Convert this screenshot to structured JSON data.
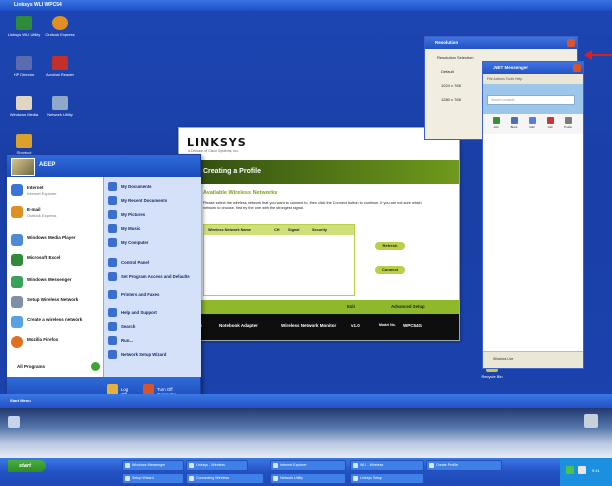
{
  "upper_window_title": "Linksys WLI WPC54",
  "desktop_icons": [
    {
      "label": "Linksys WLI Utility",
      "color": "#2e8b3b"
    },
    {
      "label": "Outlook Express",
      "color": "#e08f22"
    },
    {
      "label": "HP Director",
      "color": "#5a6cae"
    },
    {
      "label": "Acrobat Reader",
      "color": "#c2302b"
    },
    {
      "label": "Windows Media",
      "color": "#e0d6c1"
    },
    {
      "label": "Network Utility",
      "color": "#8fa7c8"
    },
    {
      "label": "Shortcut",
      "color": "#d9a22d"
    },
    {
      "label": "Recycle Bin",
      "color": "#c9c34a"
    }
  ],
  "start_menu": {
    "user_name": "AEEP",
    "left_items": [
      {
        "title": "Internet",
        "sub": "Internet Explorer",
        "color": "#3a74d8"
      },
      {
        "title": "E-mail",
        "sub": "Outlook Express",
        "color": "#e08f22"
      },
      {
        "title": "Windows Media Player",
        "sub": "",
        "color": "#4e8ad1"
      },
      {
        "title": "Microsoft Excel",
        "sub": "",
        "color": "#2f8a3b"
      },
      {
        "title": "Windows Messenger",
        "sub": "",
        "color": "#3aa15c"
      },
      {
        "title": "Setup Wireless Network",
        "sub": "",
        "color": "#7e8fa7"
      },
      {
        "title": "Create a wireless network",
        "sub": "",
        "color": "#56a2e3"
      },
      {
        "title": "Mozilla Firefox",
        "sub": "",
        "color": "#e07020"
      }
    ],
    "all_programs": "All Programs",
    "right_items": [
      "My Documents",
      "My Recent Documents",
      "My Pictures",
      "My Music",
      "My Computer",
      "Control Panel",
      "Set Program Access and Defaults",
      "Printers and Faxes",
      "Help and Support",
      "Search",
      "Run...",
      "Network Setup Wizard"
    ],
    "log_off": "Log Off",
    "turn_off": "Turn Off Computer"
  },
  "linksys": {
    "logo": "LINKSYS",
    "logo_sub": "A Division of Cisco Systems, Inc.",
    "heading": "Creating a Profile",
    "section_title": "Available Wireless Networks",
    "description": "Please select the wireless network that you want to connect to, then click the Connect button to continue. If you are not sure which network to choose, first try the one with the strongest signal.",
    "columns": [
      "Wireless Network Name",
      "CH",
      "Signal",
      "Security"
    ],
    "refresh_button": "Refresh",
    "connect_button": "Connect",
    "exit_label": "Exit",
    "advanced_label": "Advanced Setup",
    "status_speed": "802.11G",
    "status_product": "Notebook Adapter",
    "status_monitor": "Wireless Network Monitor",
    "status_version": "v1.0",
    "status_model_label": "Model No.",
    "status_model": "WPC54G"
  },
  "resolution_dialog": {
    "title": "Resolution",
    "prompt": "Resolution Selection",
    "options": [
      "Default",
      "1024 x 768",
      "1280 x 768"
    ]
  },
  "messenger": {
    "title": ".NET Messenger",
    "menu": "File  Actions  Tools  Help",
    "search_placeholder": "Search contacts",
    "tools": [
      "Add",
      "Block",
      "Mail",
      "Call",
      "Profile"
    ],
    "status_text": "Windows Live"
  },
  "middle_taskbar_label": "Start Menu",
  "taskbar": {
    "start_label": "start",
    "buttons_row1": [
      "Windows Messenger",
      "Linksys - Wireless",
      "Internet Explorer",
      "WLI - Wireless",
      "Create Profile"
    ],
    "buttons_row2": [
      "Setup Wizard",
      "Connecting Wireless",
      "Network Utility",
      "Linksys Setup"
    ],
    "clock": "9:41"
  }
}
